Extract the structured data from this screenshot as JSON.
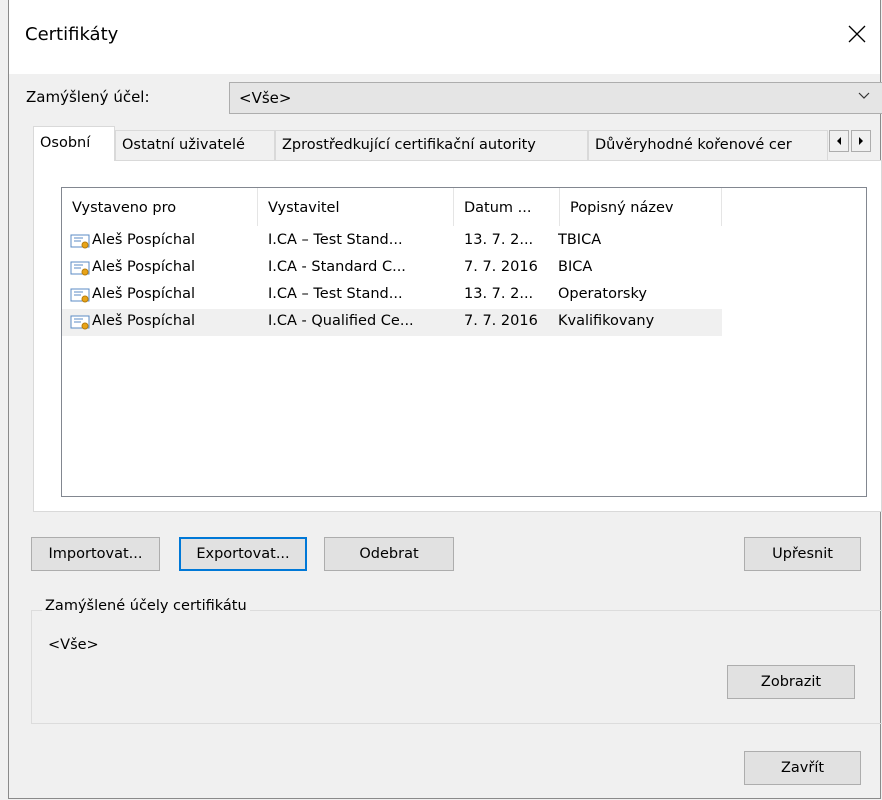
{
  "window": {
    "title": "Certifikáty"
  },
  "purpose": {
    "label": "Zamýšlený účel:",
    "value": "<Vše>"
  },
  "tabs": [
    {
      "label": "Osobní",
      "active": true
    },
    {
      "label": "Ostatní uživatelé"
    },
    {
      "label": "Zprostředkující certifikační autority"
    },
    {
      "label": "Důvěryhodné kořenové cer"
    }
  ],
  "list": {
    "columns": [
      "Vystaveno pro",
      "Vystavitel",
      "Datum ...",
      "Popisný název"
    ],
    "rows": [
      {
        "issued_to": "Aleš Pospíchal",
        "issuer": "I.CA – Test Stand...",
        "date": "13. 7. 2...",
        "name": "TBICA"
      },
      {
        "issued_to": "Aleš Pospíchal",
        "issuer": "I.CA - Standard C...",
        "date": "7. 7. 2016",
        "name": "BICA"
      },
      {
        "issued_to": "Aleš Pospíchal",
        "issuer": "I.CA – Test Stand...",
        "date": "13. 7. 2...",
        "name": "Operatorsky"
      },
      {
        "issued_to": "Aleš Pospíchal",
        "issuer": "I.CA - Qualified Ce...",
        "date": "7. 7. 2016",
        "name": "Kvalifikovany"
      }
    ]
  },
  "buttons": {
    "import": "Importovat...",
    "export": "Exportovat...",
    "remove": "Odebrat",
    "advanced": "Upřesnit",
    "view": "Zobrazit",
    "close": "Zavřít"
  },
  "purposes_group": {
    "title": "Zamýšlené účely certifikátu",
    "value": "<Vše>"
  }
}
